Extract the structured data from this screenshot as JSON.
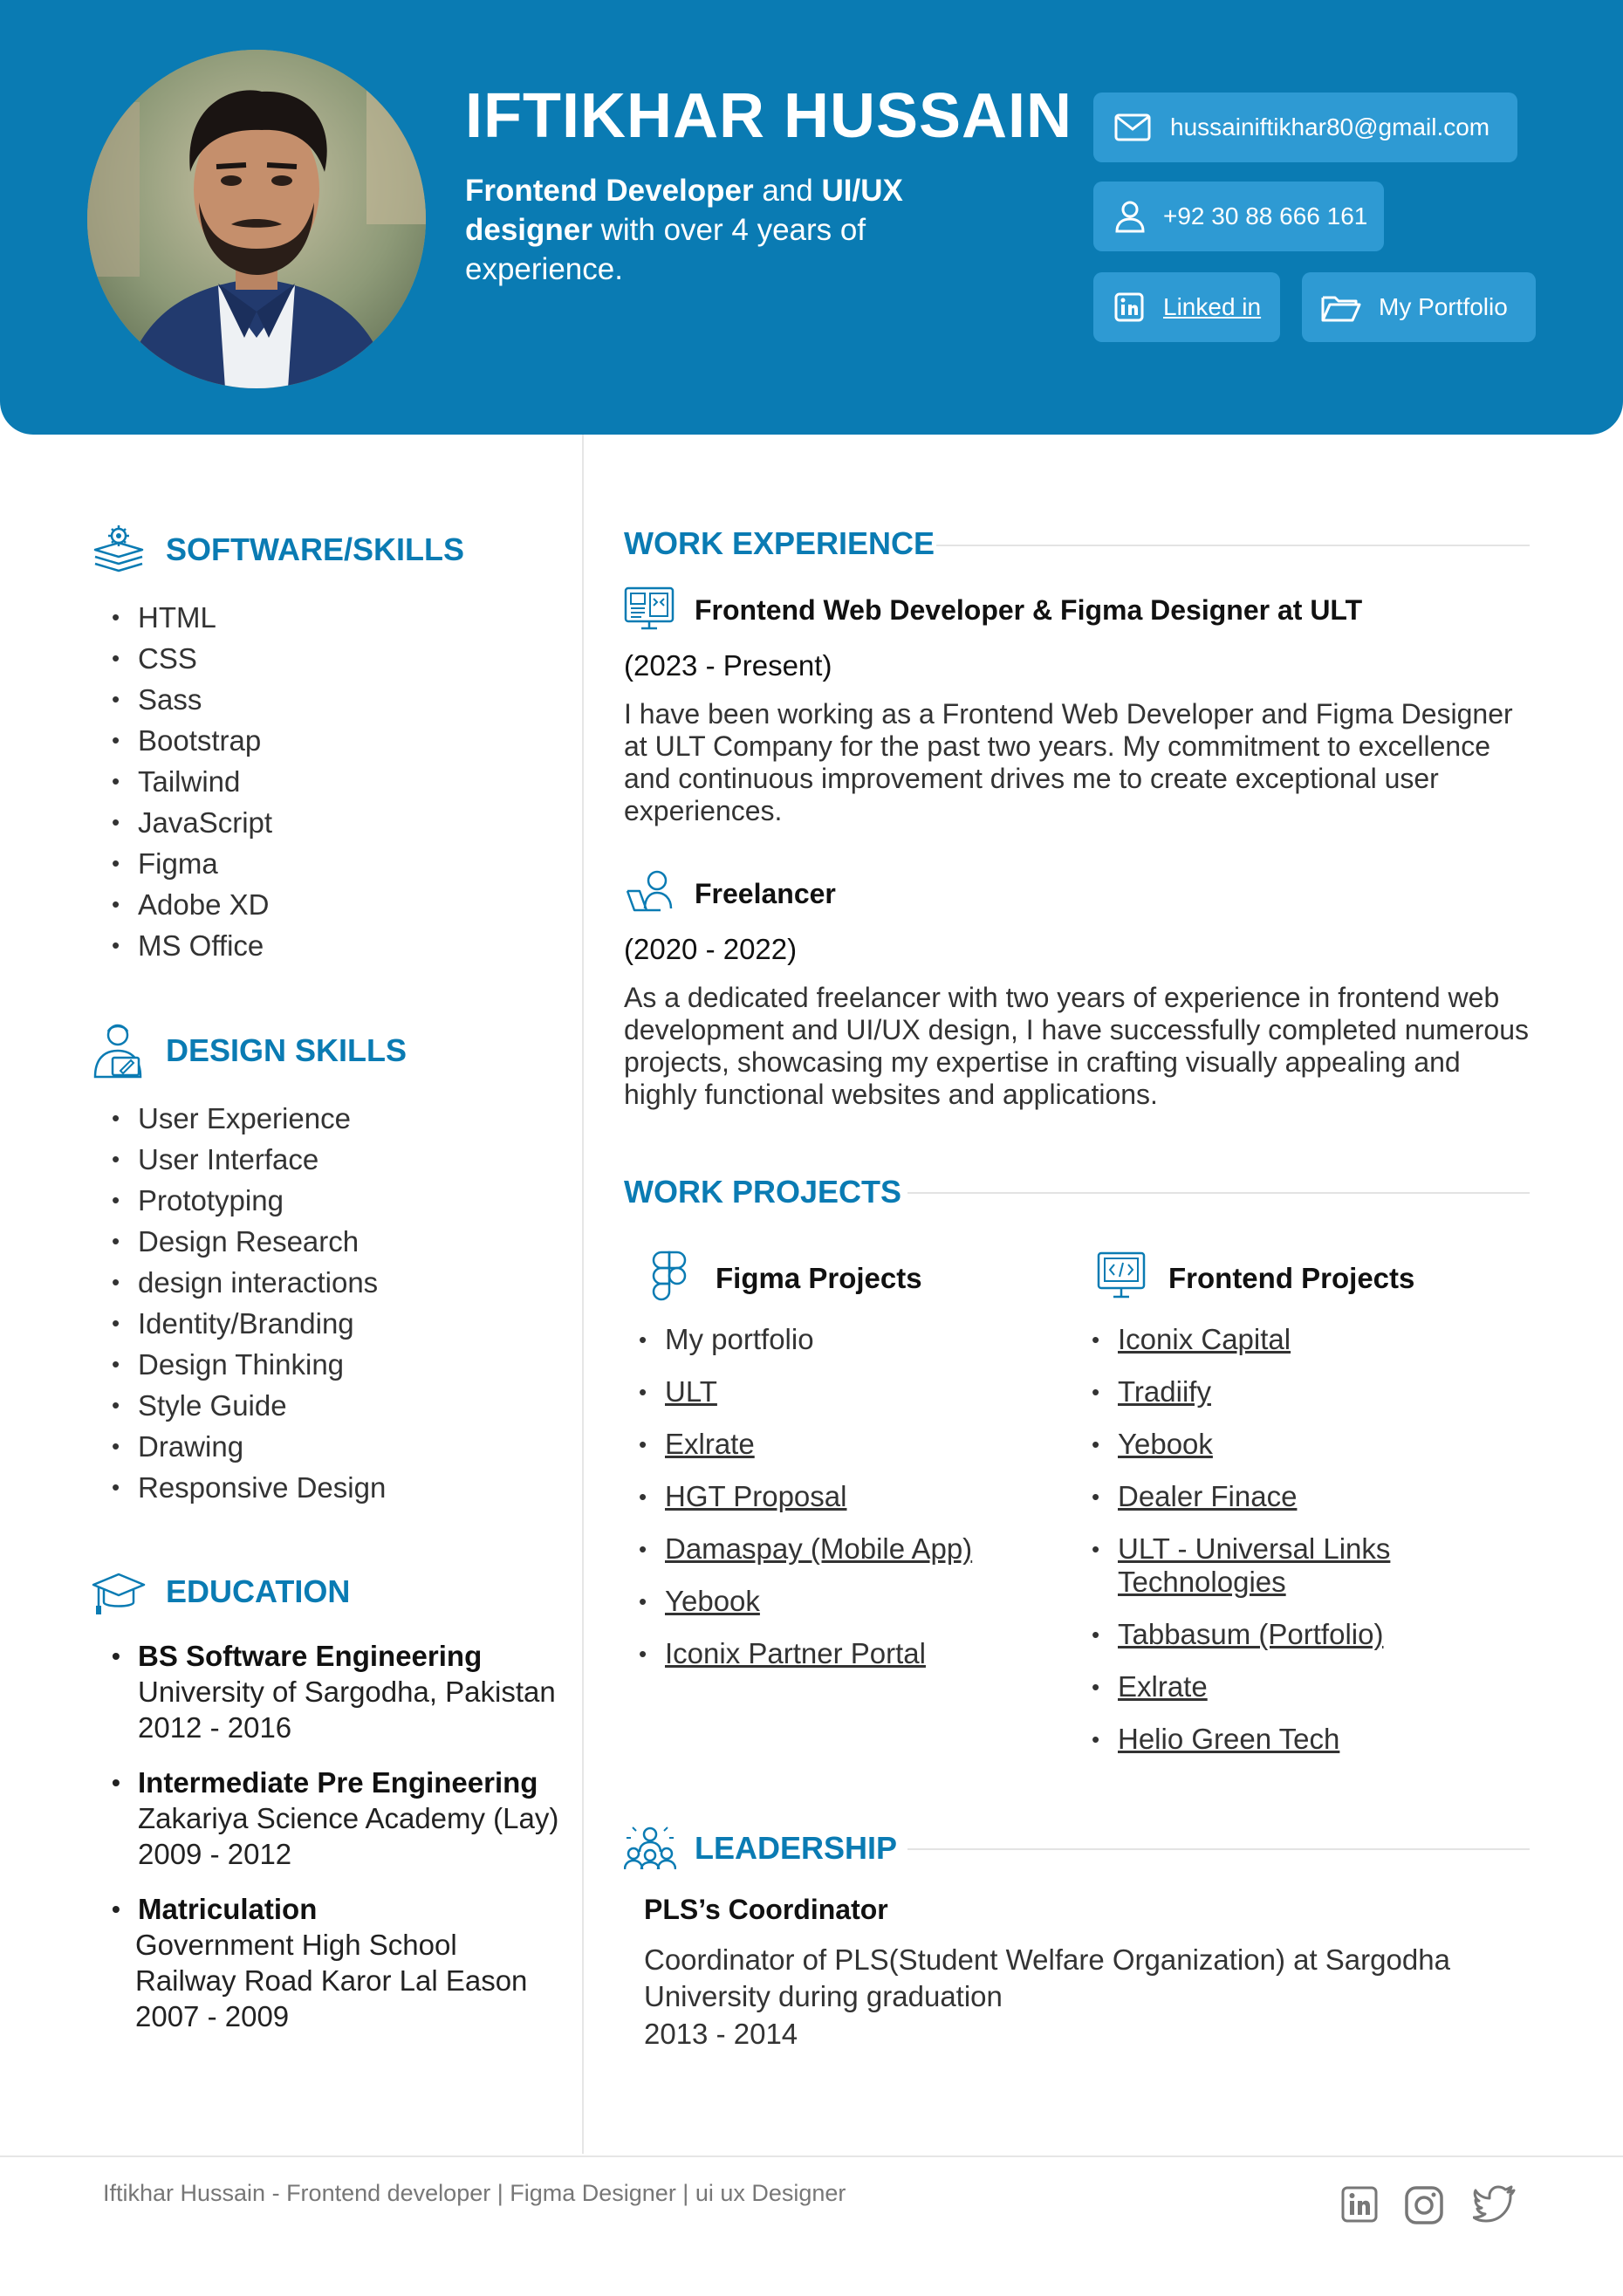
{
  "header": {
    "name": "IFTIKHAR HUSSAIN",
    "tagline_role1": "Frontend Developer",
    "tagline_and": " and ",
    "tagline_role2": "UI/UX designer",
    "tagline_rest": " with over 4 years of experience.",
    "email": "hussainiftikhar80@gmail.com",
    "phone": "+92 30 88 666 161",
    "linkedin": "Linked in",
    "portfolio": "My Portfolio",
    "accent": "#0a7bb3",
    "pill_color": "#2e9ad3"
  },
  "skills": {
    "title": "SOFTWARE/SKILLS",
    "items": [
      "HTML",
      "CSS",
      "Sass",
      "Bootstrap",
      "Tailwind",
      "JavaScript",
      "Figma",
      "Adobe XD",
      "MS Office"
    ]
  },
  "design_skills": {
    "title": "DESIGN SKILLS",
    "items": [
      "User Experience",
      "User Interface",
      "Prototyping",
      "Design Research",
      "design interactions",
      "Identity/Branding",
      "Design Thinking",
      "Style Guide",
      "Drawing",
      "Responsive Design"
    ]
  },
  "education": {
    "title": "EDUCATION",
    "items": [
      {
        "degree": "BS Software Engineering",
        "lines": [
          "University of Sargodha, Pakistan",
          "2012 - 2016"
        ]
      },
      {
        "degree": "Intermediate Pre Engineering",
        "lines": [
          "Zakariya Science Academy (Lay)",
          "2009 - 2012"
        ]
      },
      {
        "degree": "Matriculation",
        "lines": [
          "Government High School",
          "Railway Road Karor Lal Eason",
          "2007 - 2009"
        ]
      }
    ]
  },
  "work": {
    "title": "WORK EXPERIENCE",
    "jobs": [
      {
        "title": "Frontend Web Developer & Figma Designer at ULT",
        "period": "(2023 - Present)",
        "desc": "I have been working as a Frontend Web Developer and Figma Designer at ULT Company for the past two years. My commitment to excellence and continuous improvement drives me to create exceptional user experiences."
      },
      {
        "title": "Freelancer",
        "period": "(2020 - 2022)",
        "desc": "As a dedicated freelancer with two years of experience in frontend web development and UI/UX design, I have successfully completed numerous projects, showcasing my expertise in crafting visually appealing and highly functional websites and applications."
      }
    ]
  },
  "projects": {
    "title": "WORK PROJECTS",
    "figma_title": "Figma Projects",
    "figma": [
      "My portfolio",
      "ULT",
      "Exlrate",
      "HGT Proposal",
      "Damaspay (Mobile App)",
      "Yebook",
      "Iconix Partner Portal"
    ],
    "frontend_title": "Frontend Projects",
    "frontend": [
      "Iconix Capital",
      "Tradiify",
      "Yebook",
      "Dealer Finace",
      "ULT - Universal Links Technologies",
      "Tabbasum (Portfolio)",
      "Exlrate",
      "Helio Green Tech"
    ]
  },
  "leadership": {
    "title": "LEADERSHIP",
    "role": "PLS’s Coordinator",
    "desc": "Coordinator of PLS(Student Welfare Organization) at Sargodha University during graduation",
    "period": "2013 - 2014"
  },
  "footer": {
    "text": "Iftikhar Hussain - Frontend developer | Figma Designer | ui ux Designer",
    "icons": [
      "linkedin-icon",
      "instagram-icon",
      "twitter-icon"
    ]
  }
}
